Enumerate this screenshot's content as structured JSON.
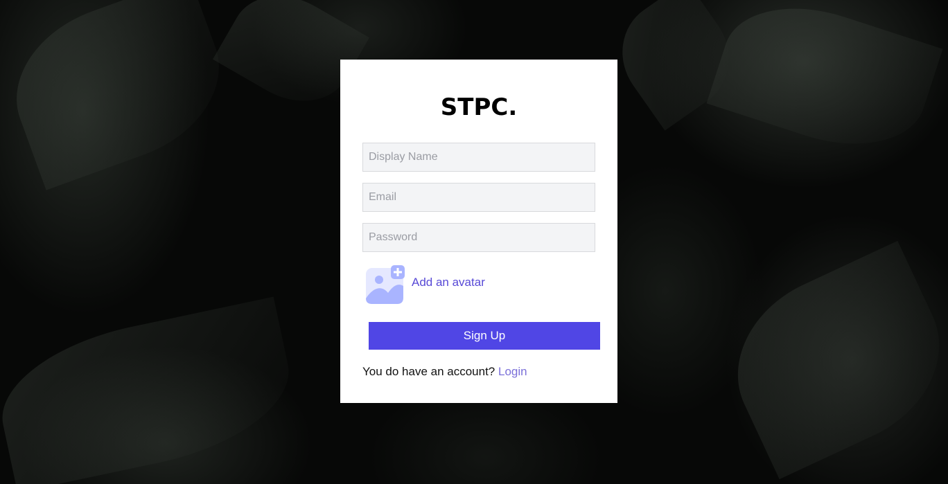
{
  "brand": {
    "logo_text": "STPC."
  },
  "form": {
    "display_name": {
      "placeholder": "Display Name",
      "value": ""
    },
    "email": {
      "placeholder": "Email",
      "value": ""
    },
    "password": {
      "placeholder": "Password",
      "value": ""
    },
    "avatar_label": "Add an avatar",
    "avatar_icon": "add-image-icon",
    "submit_label": "Sign Up"
  },
  "footer": {
    "prompt": "You do have an account?",
    "login_label": "Login"
  },
  "colors": {
    "accent": "#5046e5",
    "link": "#5749d6",
    "input_bg": "#f3f4f6"
  }
}
